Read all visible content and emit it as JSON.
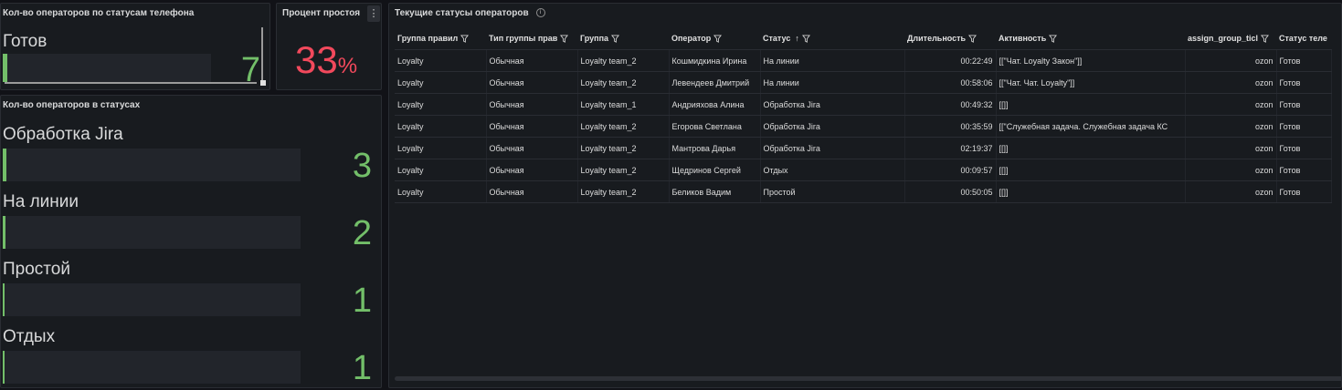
{
  "colors": {
    "accent_green": "#73bf69",
    "accent_red": "#f2495c",
    "panel_bg": "#181b1f",
    "page_bg": "#111217"
  },
  "phone_panel": {
    "title": "Кол-во операторов по статусам телефона",
    "rows": [
      {
        "label": "Готов",
        "value": "7",
        "fraction": 0.02
      }
    ]
  },
  "idle_panel": {
    "title": "Процент простоя",
    "value": "33",
    "unit": "%",
    "menu_icon": "vertical-dots-icon"
  },
  "status_panel": {
    "title": "Кол-во операторов в статусах",
    "rows": [
      {
        "label": "Обработка Jira",
        "value": "3",
        "fraction": 0.02
      },
      {
        "label": "На линии",
        "value": "2",
        "fraction": 0.015
      },
      {
        "label": "Простой",
        "value": "1",
        "fraction": 0.008
      },
      {
        "label": "Отдых",
        "value": "1",
        "fraction": 0.008
      }
    ]
  },
  "table_panel": {
    "title": "Текущие статусы операторов",
    "info_icon": "info-icon",
    "columns": [
      {
        "label": "Группа правил",
        "filter": true
      },
      {
        "label": "Тип группы прав",
        "filter": true
      },
      {
        "label": "Группа",
        "filter": true
      },
      {
        "label": "Оператор",
        "filter": true
      },
      {
        "label": "Статус",
        "sort": "↑",
        "filter": true
      },
      {
        "label": "Длительность",
        "filter": true
      },
      {
        "label": "Активность",
        "filter": true
      },
      {
        "label": "assign_group_ticl",
        "filter": true
      },
      {
        "label": "Статус теле",
        "filter": false
      }
    ],
    "rows": [
      [
        "Loyalty",
        "Обычная",
        "Loyalty team_2",
        "Кошмидкина Ирина",
        "На линии",
        "00:22:49",
        "[[\"Чат. Loyalty Закон\"]]",
        "ozon",
        "Готов"
      ],
      [
        "Loyalty",
        "Обычная",
        "Loyalty team_2",
        "Левендеев Дмитрий",
        "На линии",
        "00:58:06",
        "[[\"Чат. Чат. Loyalty\"]]",
        "ozon",
        "Готов"
      ],
      [
        "Loyalty",
        "Обычная",
        "Loyalty team_1",
        "Андрияхова Алина",
        "Обработка Jira",
        "00:49:32",
        "[[]]",
        "ozon",
        "Готов"
      ],
      [
        "Loyalty",
        "Обычная",
        "Loyalty team_2",
        "Егорова Светлана",
        "Обработка Jira",
        "00:35:59",
        "[[\"Служебная задача. Служебная задача КС",
        "ozon",
        "Готов"
      ],
      [
        "Loyalty",
        "Обычная",
        "Loyalty team_2",
        "Мантрова Дарья",
        "Обработка Jira",
        "02:19:37",
        "[[]]",
        "ozon",
        "Готов"
      ],
      [
        "Loyalty",
        "Обычная",
        "Loyalty team_2",
        "Щедринов Сергей",
        "Отдых",
        "00:09:57",
        "[[]]",
        "ozon",
        "Готов"
      ],
      [
        "Loyalty",
        "Обычная",
        "Loyalty team_2",
        "Беликов Вадим",
        "Простой",
        "00:50:05",
        "[[]]",
        "ozon",
        "Готов"
      ]
    ]
  }
}
